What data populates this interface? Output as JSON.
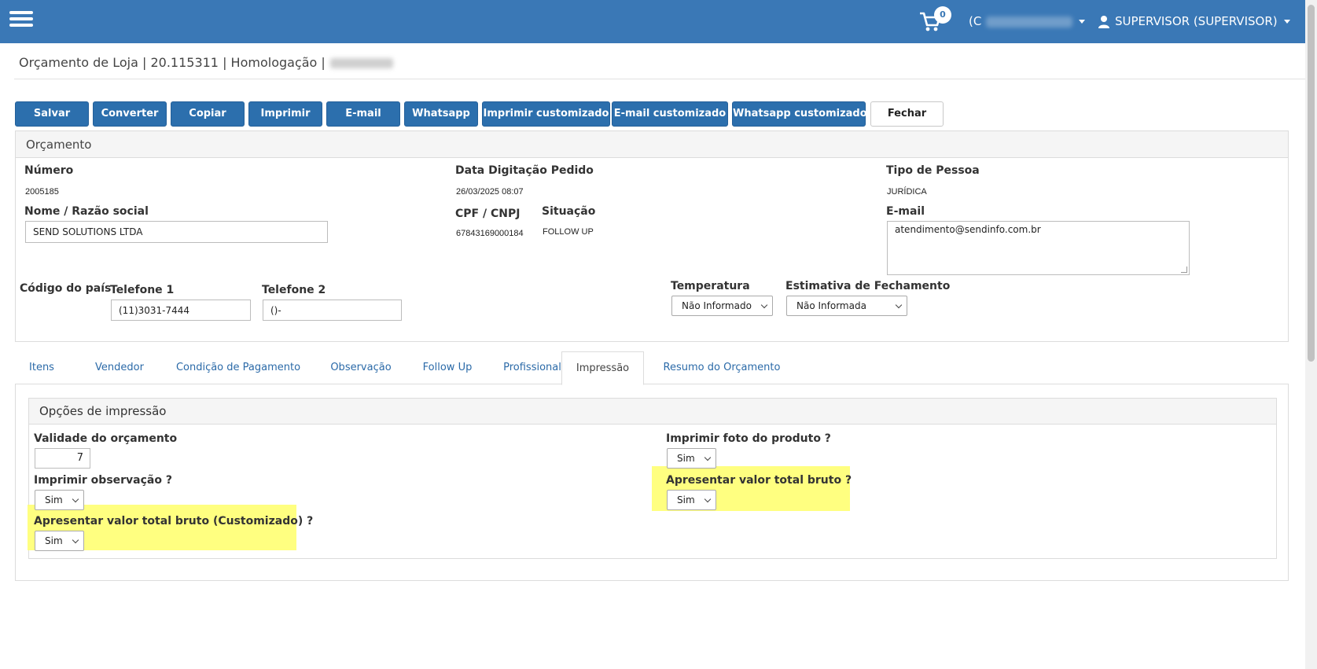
{
  "topbar": {
    "cart_count": "0",
    "account_selector": "(C",
    "user_label": "SUPERVISOR (SUPERVISOR)"
  },
  "page": {
    "title": "Orçamento de Loja | 20.115311 | Homologação |"
  },
  "toolbar": {
    "buttons": [
      "Salvar",
      "Converter",
      "Copiar",
      "Imprimir",
      "E-mail",
      "Whatsapp",
      "Imprimir customizado",
      "E-mail customizado",
      "Whatsapp customizado",
      "Fechar"
    ]
  },
  "orcamento": {
    "heading": "Orçamento",
    "numero_label": "Número",
    "numero_value": "2005185",
    "data_label": "Data Digitação Pedido",
    "data_value": "26/03/2025 08:07",
    "tipo_label": "Tipo de Pessoa",
    "tipo_value": "JURÍDICA",
    "nome_label": "Nome / Razão social",
    "nome_value": "SEND SOLUTIONS LTDA",
    "cpf_label": "CPF / CNPJ",
    "cpf_value": "67843169000184",
    "situacao_label": "Situação",
    "situacao_value": "FOLLOW UP",
    "email_label": "E-mail",
    "email_value": "atendimento@sendinfo.com.br",
    "codigo_pais_label": "Código do país",
    "telefone1_label": "Telefone 1",
    "telefone1_value": "(11)3031-7444",
    "telefone2_label": "Telefone 2",
    "telefone2_value": "()-",
    "temperatura_label": "Temperatura",
    "temperatura_value": "Não Informado",
    "estimativa_label": "Estimativa de Fechamento",
    "estimativa_value": "Não Informada"
  },
  "tabs": [
    "Itens",
    "Vendedor",
    "Condição de Pagamento",
    "Observação",
    "Follow Up",
    "Profissional",
    "Impressão",
    "Resumo do Orçamento"
  ],
  "active_tab": "Impressão",
  "impressao": {
    "heading": "Opções de impressão",
    "validade_label": "Validade do orçamento",
    "validade_value": "7",
    "imprimir_obs_label": "Imprimir observação ?",
    "imprimir_obs_value": "Sim",
    "bruto_custom_label": "Apresentar valor total bruto (Customizado) ?",
    "bruto_custom_value": "Sim",
    "foto_label": "Imprimir foto do produto ?",
    "foto_value": "Sim",
    "bruto_label": "Apresentar valor total bruto ?",
    "bruto_value": "Sim"
  },
  "colors": {
    "topbar": "#3a78b6",
    "button": "#2c6fad",
    "highlight": "#ffff80",
    "link": "#2b6aa8"
  }
}
